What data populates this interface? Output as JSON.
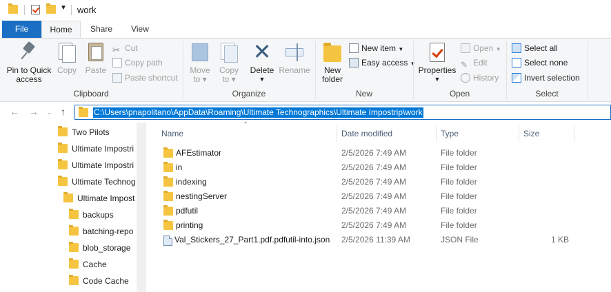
{
  "window": {
    "title": "work"
  },
  "tabs": {
    "file": "File",
    "home": "Home",
    "share": "Share",
    "view": "View"
  },
  "ribbon": {
    "clipboard": {
      "label": "Clipboard",
      "pin": "Pin to Quick access",
      "pin_line1": "Pin to Quick",
      "pin_line2": "access",
      "copy": "Copy",
      "paste": "Paste",
      "cut": "Cut",
      "copy_path": "Copy path",
      "paste_shortcut": "Paste shortcut"
    },
    "organize": {
      "label": "Organize",
      "move_to": "Move",
      "move_to2": "to",
      "copy_to": "Copy",
      "copy_to2": "to",
      "delete": "Delete",
      "rename": "Rename"
    },
    "new": {
      "label": "New",
      "new_folder1": "New",
      "new_folder2": "folder",
      "new_item": "New item",
      "easy_access": "Easy access"
    },
    "open": {
      "label": "Open",
      "properties": "Properties",
      "open": "Open",
      "edit": "Edit",
      "history": "History"
    },
    "select": {
      "label": "Select",
      "select_all": "Select all",
      "select_none": "Select none",
      "invert": "Invert selection"
    }
  },
  "address": {
    "path": "C:\\Users\\pnapolitano\\AppData\\Roaming\\Ultimate Technographics\\Ultimate Impostrip\\work"
  },
  "navpane": {
    "items": [
      {
        "label": "Two Pilots"
      },
      {
        "label": "Ultimate Impostri"
      },
      {
        "label": "Ultimate Impostri"
      },
      {
        "label": "Ultimate Technog"
      },
      {
        "label": "Ultimate Impost"
      },
      {
        "label": "backups"
      },
      {
        "label": "batching-repo"
      },
      {
        "label": "blob_storage"
      },
      {
        "label": "Cache"
      },
      {
        "label": "Code Cache"
      }
    ]
  },
  "columns": {
    "name": "Name",
    "date": "Date modified",
    "type": "Type",
    "size": "Size"
  },
  "files": [
    {
      "name": "AFEstimator",
      "date": "2/5/2026 7:49 AM",
      "type": "File folder",
      "size": "",
      "icon": "folder-icon"
    },
    {
      "name": "in",
      "date": "2/5/2026 7:49 AM",
      "type": "File folder",
      "size": "",
      "icon": "folder-icon"
    },
    {
      "name": "indexing",
      "date": "2/5/2026 7:49 AM",
      "type": "File folder",
      "size": "",
      "icon": "folder-icon"
    },
    {
      "name": "nestingServer",
      "date": "2/5/2026 7:49 AM",
      "type": "File folder",
      "size": "",
      "icon": "folder-icon"
    },
    {
      "name": "pdfutil",
      "date": "2/5/2026 7:49 AM",
      "type": "File folder",
      "size": "",
      "icon": "folder-icon"
    },
    {
      "name": "printing",
      "date": "2/5/2026 7:49 AM",
      "type": "File folder",
      "size": "",
      "icon": "folder-icon"
    },
    {
      "name": "Val_Stickers_27_Part1.pdf.pdfutil-into.json",
      "date": "2/5/2026 11:39 AM",
      "type": "JSON File",
      "size": "1 KB",
      "icon": "json-file-icon"
    }
  ],
  "colors": {
    "accent": "#1a6fc4",
    "selection": "#0078d7",
    "folder": "#f5c542"
  }
}
